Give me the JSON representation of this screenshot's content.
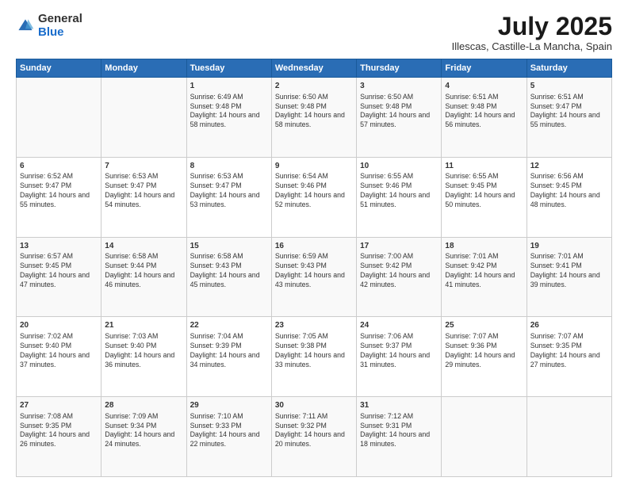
{
  "header": {
    "logo_general": "General",
    "logo_blue": "Blue",
    "month_title": "July 2025",
    "location": "Illescas, Castille-La Mancha, Spain"
  },
  "weekdays": [
    "Sunday",
    "Monday",
    "Tuesday",
    "Wednesday",
    "Thursday",
    "Friday",
    "Saturday"
  ],
  "weeks": [
    [
      {
        "day": "",
        "sunrise": "",
        "sunset": "",
        "daylight": ""
      },
      {
        "day": "",
        "sunrise": "",
        "sunset": "",
        "daylight": ""
      },
      {
        "day": "1",
        "sunrise": "Sunrise: 6:49 AM",
        "sunset": "Sunset: 9:48 PM",
        "daylight": "Daylight: 14 hours and 58 minutes."
      },
      {
        "day": "2",
        "sunrise": "Sunrise: 6:50 AM",
        "sunset": "Sunset: 9:48 PM",
        "daylight": "Daylight: 14 hours and 58 minutes."
      },
      {
        "day": "3",
        "sunrise": "Sunrise: 6:50 AM",
        "sunset": "Sunset: 9:48 PM",
        "daylight": "Daylight: 14 hours and 57 minutes."
      },
      {
        "day": "4",
        "sunrise": "Sunrise: 6:51 AM",
        "sunset": "Sunset: 9:48 PM",
        "daylight": "Daylight: 14 hours and 56 minutes."
      },
      {
        "day": "5",
        "sunrise": "Sunrise: 6:51 AM",
        "sunset": "Sunset: 9:47 PM",
        "daylight": "Daylight: 14 hours and 55 minutes."
      }
    ],
    [
      {
        "day": "6",
        "sunrise": "Sunrise: 6:52 AM",
        "sunset": "Sunset: 9:47 PM",
        "daylight": "Daylight: 14 hours and 55 minutes."
      },
      {
        "day": "7",
        "sunrise": "Sunrise: 6:53 AM",
        "sunset": "Sunset: 9:47 PM",
        "daylight": "Daylight: 14 hours and 54 minutes."
      },
      {
        "day": "8",
        "sunrise": "Sunrise: 6:53 AM",
        "sunset": "Sunset: 9:47 PM",
        "daylight": "Daylight: 14 hours and 53 minutes."
      },
      {
        "day": "9",
        "sunrise": "Sunrise: 6:54 AM",
        "sunset": "Sunset: 9:46 PM",
        "daylight": "Daylight: 14 hours and 52 minutes."
      },
      {
        "day": "10",
        "sunrise": "Sunrise: 6:55 AM",
        "sunset": "Sunset: 9:46 PM",
        "daylight": "Daylight: 14 hours and 51 minutes."
      },
      {
        "day": "11",
        "sunrise": "Sunrise: 6:55 AM",
        "sunset": "Sunset: 9:45 PM",
        "daylight": "Daylight: 14 hours and 50 minutes."
      },
      {
        "day": "12",
        "sunrise": "Sunrise: 6:56 AM",
        "sunset": "Sunset: 9:45 PM",
        "daylight": "Daylight: 14 hours and 48 minutes."
      }
    ],
    [
      {
        "day": "13",
        "sunrise": "Sunrise: 6:57 AM",
        "sunset": "Sunset: 9:45 PM",
        "daylight": "Daylight: 14 hours and 47 minutes."
      },
      {
        "day": "14",
        "sunrise": "Sunrise: 6:58 AM",
        "sunset": "Sunset: 9:44 PM",
        "daylight": "Daylight: 14 hours and 46 minutes."
      },
      {
        "day": "15",
        "sunrise": "Sunrise: 6:58 AM",
        "sunset": "Sunset: 9:43 PM",
        "daylight": "Daylight: 14 hours and 45 minutes."
      },
      {
        "day": "16",
        "sunrise": "Sunrise: 6:59 AM",
        "sunset": "Sunset: 9:43 PM",
        "daylight": "Daylight: 14 hours and 43 minutes."
      },
      {
        "day": "17",
        "sunrise": "Sunrise: 7:00 AM",
        "sunset": "Sunset: 9:42 PM",
        "daylight": "Daylight: 14 hours and 42 minutes."
      },
      {
        "day": "18",
        "sunrise": "Sunrise: 7:01 AM",
        "sunset": "Sunset: 9:42 PM",
        "daylight": "Daylight: 14 hours and 41 minutes."
      },
      {
        "day": "19",
        "sunrise": "Sunrise: 7:01 AM",
        "sunset": "Sunset: 9:41 PM",
        "daylight": "Daylight: 14 hours and 39 minutes."
      }
    ],
    [
      {
        "day": "20",
        "sunrise": "Sunrise: 7:02 AM",
        "sunset": "Sunset: 9:40 PM",
        "daylight": "Daylight: 14 hours and 37 minutes."
      },
      {
        "day": "21",
        "sunrise": "Sunrise: 7:03 AM",
        "sunset": "Sunset: 9:40 PM",
        "daylight": "Daylight: 14 hours and 36 minutes."
      },
      {
        "day": "22",
        "sunrise": "Sunrise: 7:04 AM",
        "sunset": "Sunset: 9:39 PM",
        "daylight": "Daylight: 14 hours and 34 minutes."
      },
      {
        "day": "23",
        "sunrise": "Sunrise: 7:05 AM",
        "sunset": "Sunset: 9:38 PM",
        "daylight": "Daylight: 14 hours and 33 minutes."
      },
      {
        "day": "24",
        "sunrise": "Sunrise: 7:06 AM",
        "sunset": "Sunset: 9:37 PM",
        "daylight": "Daylight: 14 hours and 31 minutes."
      },
      {
        "day": "25",
        "sunrise": "Sunrise: 7:07 AM",
        "sunset": "Sunset: 9:36 PM",
        "daylight": "Daylight: 14 hours and 29 minutes."
      },
      {
        "day": "26",
        "sunrise": "Sunrise: 7:07 AM",
        "sunset": "Sunset: 9:35 PM",
        "daylight": "Daylight: 14 hours and 27 minutes."
      }
    ],
    [
      {
        "day": "27",
        "sunrise": "Sunrise: 7:08 AM",
        "sunset": "Sunset: 9:35 PM",
        "daylight": "Daylight: 14 hours and 26 minutes."
      },
      {
        "day": "28",
        "sunrise": "Sunrise: 7:09 AM",
        "sunset": "Sunset: 9:34 PM",
        "daylight": "Daylight: 14 hours and 24 minutes."
      },
      {
        "day": "29",
        "sunrise": "Sunrise: 7:10 AM",
        "sunset": "Sunset: 9:33 PM",
        "daylight": "Daylight: 14 hours and 22 minutes."
      },
      {
        "day": "30",
        "sunrise": "Sunrise: 7:11 AM",
        "sunset": "Sunset: 9:32 PM",
        "daylight": "Daylight: 14 hours and 20 minutes."
      },
      {
        "day": "31",
        "sunrise": "Sunrise: 7:12 AM",
        "sunset": "Sunset: 9:31 PM",
        "daylight": "Daylight: 14 hours and 18 minutes."
      },
      {
        "day": "",
        "sunrise": "",
        "sunset": "",
        "daylight": ""
      },
      {
        "day": "",
        "sunrise": "",
        "sunset": "",
        "daylight": ""
      }
    ]
  ]
}
